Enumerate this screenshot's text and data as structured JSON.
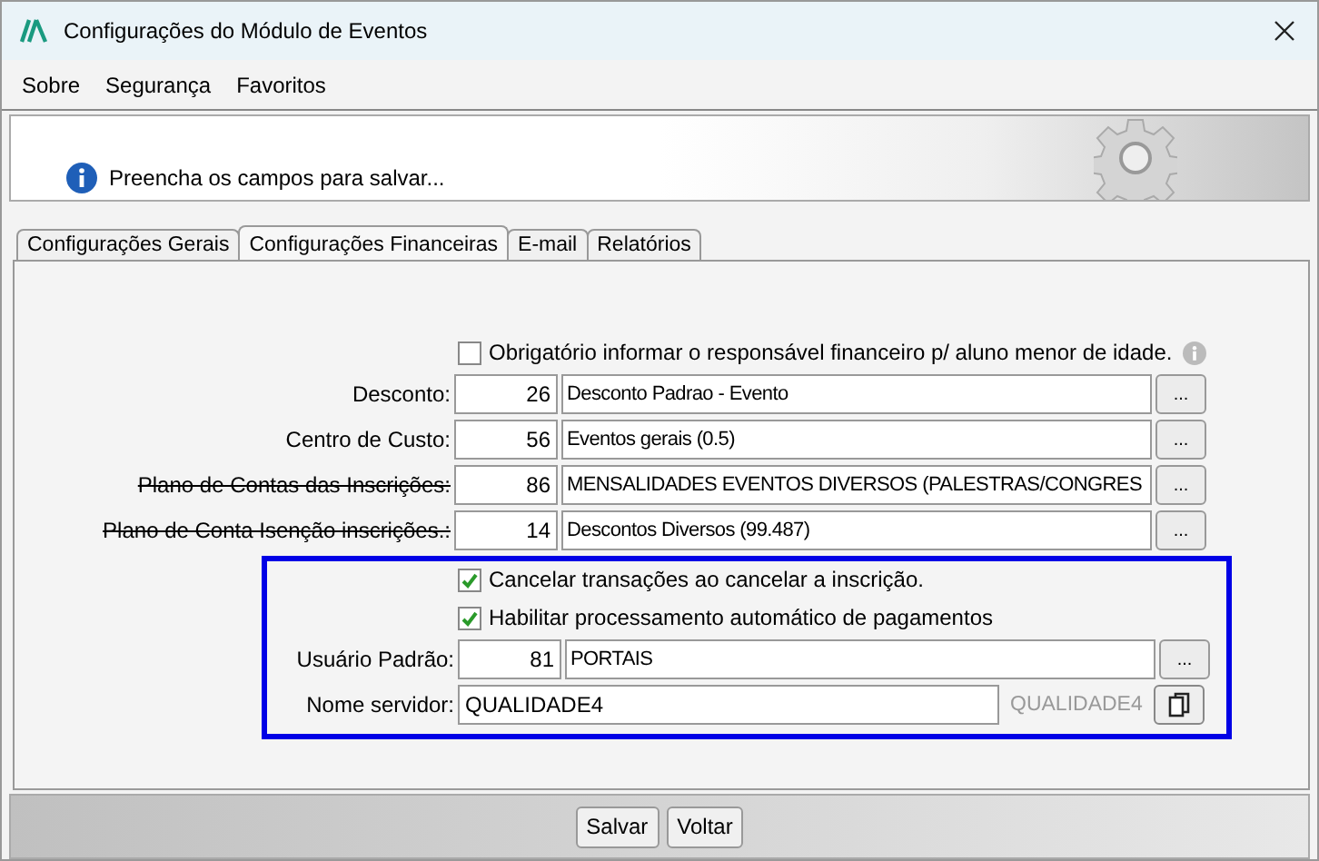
{
  "window": {
    "title": "Configurações do Módulo de Eventos"
  },
  "menu": [
    "Sobre",
    "Segurança",
    "Favoritos"
  ],
  "banner": {
    "message": "Preencha os campos para salvar..."
  },
  "tabs": [
    {
      "label": "Configurações Gerais",
      "selected": false
    },
    {
      "label": "Configurações Financeiras",
      "selected": true
    },
    {
      "label": "E-mail",
      "selected": false
    },
    {
      "label": "Relatórios",
      "selected": false
    }
  ],
  "rows": [
    {
      "kind": "checkbox",
      "label": "Obrigatório informar o responsável financeiro p/ aluno menor de idade.",
      "checked": false,
      "info": true
    },
    {
      "kind": "lookup",
      "label": "Desconto:",
      "strike": false,
      "code": "26",
      "description": "Desconto Padrao - Evento",
      "button": "..."
    },
    {
      "kind": "lookup",
      "label": "Centro de Custo:",
      "strike": false,
      "code": "56",
      "description": "Eventos gerais (0.5)",
      "button": "..."
    },
    {
      "kind": "lookup",
      "label": "Plano de Contas das Inscrições:",
      "strike": true,
      "code": "86",
      "description": "MENSALIDADES EVENTOS DIVERSOS (PALESTRAS/CONGRES",
      "button": "..."
    },
    {
      "kind": "lookup",
      "label": "Plano de Conta Isenção inscrições.:",
      "strike": true,
      "code": "14",
      "description": "Descontos Diversos (99.487)",
      "button": "..."
    }
  ],
  "highlighted_rows": [
    {
      "kind": "checkbox",
      "label": "Cancelar transações ao cancelar a inscrição.",
      "checked": true
    },
    {
      "kind": "checkbox",
      "label": "Habilitar processamento automático de pagamentos",
      "checked": true
    },
    {
      "kind": "lookup",
      "label": "Usuário Padrão:",
      "strike": false,
      "code": "81",
      "description": "PORTAIS",
      "button": "..."
    },
    {
      "kind": "server",
      "label": "Nome servidor:",
      "value": "QUALIDADE4",
      "hint": "QUALIDADE4"
    }
  ],
  "buttons": [
    "Salvar",
    "Voltar"
  ]
}
